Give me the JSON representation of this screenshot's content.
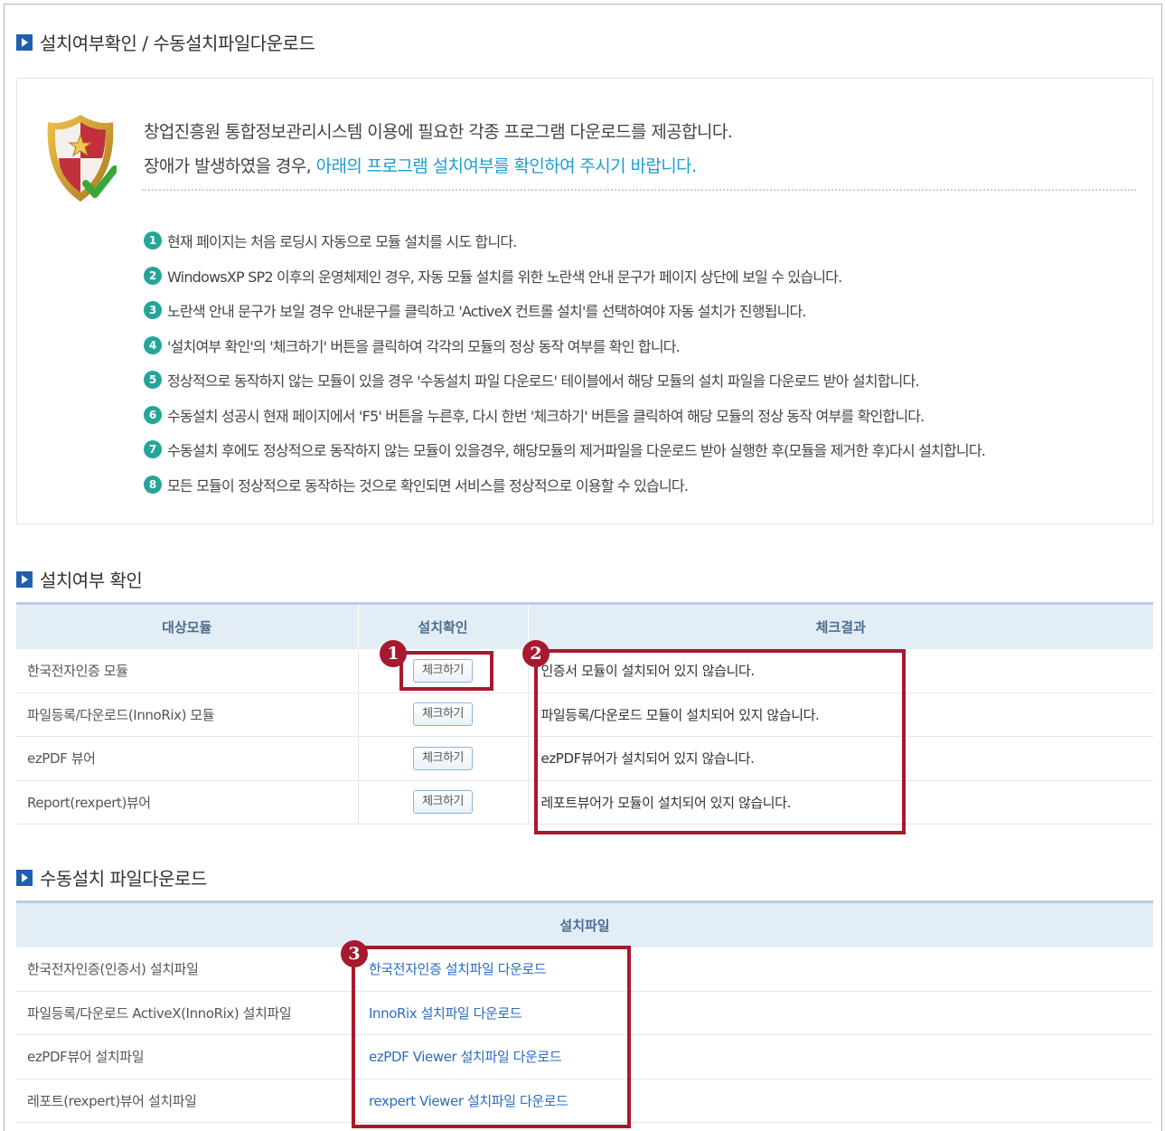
{
  "sections": {
    "main_title": "설치여부확인 / 수동설치파일다운로드",
    "check_title": "설치여부 확인",
    "download_title": "수동설치 파일다운로드"
  },
  "intro": {
    "line1": "창업진흥원 통합정보관리시스템 이용에 필요한 각종 프로그램 다운로드를 제공합니다.",
    "line2_plain": "장애가 발생하였을 경우, ",
    "line2_highlight": "아래의 프로그램 설치여부를 확인하여 주시기 바랍니다."
  },
  "steps": [
    {
      "num": "1",
      "text": "현재 페이지는 처음 로딩시 자동으로 모듈 설치를 시도 합니다."
    },
    {
      "num": "2",
      "text": "WindowsXP SP2 이후의 운영체제인 경우, 자동 모듈 설치를 위한 노란색 안내 문구가 페이지 상단에 보일 수 있습니다."
    },
    {
      "num": "3",
      "text": "노란색 안내 문구가 보일 경우 안내문구를 클릭하고 'ActiveX 컨트롤 설치'를 선택하여야 자동 설치가 진행됩니다."
    },
    {
      "num": "4",
      "text": "'설치여부 확인'의 '체크하기' 버튼을 클릭하여 각각의 모듈의 정상 동작 여부를 확인 합니다."
    },
    {
      "num": "5",
      "text": "정상적으로 동작하지 않는 모듈이 있을 경우 '수동설치 파일 다운로드' 테이블에서 해당 모듈의 설치 파일을 다운로드 받아 설치합니다."
    },
    {
      "num": "6",
      "text": "수동설치 성공시 현재 페이지에서 'F5' 버튼을 누른후, 다시 한번 '체크하기' 버튼을 클릭하여 해당 모듈의 정상 동작 여부를 확인합니다."
    },
    {
      "num": "7",
      "text": "수동설치 후에도 정상적으로 동작하지 않는 모듈이 있을경우, 해당모듈의 제거파일을 다운로드 받아 실행한 후(모듈을 제거한 후)다시 설치합니다."
    },
    {
      "num": "8",
      "text": "모든 모듈이 정상적으로 동작하는 것으로 확인되면 서비스를 정상적으로 이용할 수 있습니다."
    }
  ],
  "check_table": {
    "headers": [
      "대상모듈",
      "설치확인",
      "체크결과"
    ],
    "button_label": "체크하기",
    "rows": [
      {
        "module": "한국전자인증 모듈",
        "result": "인증서 모듈이 설치되어 있지 않습니다."
      },
      {
        "module": "파일등록/다운로드(InnoRix) 모듈",
        "result": "파일등록/다운로드 모듈이 설치되어 있지 않습니다."
      },
      {
        "module": "ezPDF 뷰어",
        "result": "ezPDF뷰어가 설치되어 있지 않습니다."
      },
      {
        "module": "Report(rexpert)뷰어",
        "result": "레포트뷰어가 모듈이 설치되어 있지 않습니다."
      }
    ]
  },
  "download_table": {
    "header": "설치파일",
    "rows": [
      {
        "name": "한국전자인증(인증서) 설치파일",
        "link": "한국전자인증 설치파일 다운로드"
      },
      {
        "name": "파일등록/다운로드 ActiveX(InnoRix) 설치파일",
        "link": "InnoRix 설치파일 다운로드"
      },
      {
        "name": "ezPDF뷰어 설치파일",
        "link": "ezPDF Viewer 설치파일 다운로드"
      },
      {
        "name": "레포트(rexpert)뷰어 설치파일",
        "link": "rexpert Viewer 설치파일 다운로드"
      }
    ]
  },
  "annotations": {
    "badge1": "1",
    "badge2": "2",
    "badge3": "3"
  },
  "colors": {
    "accent_blue": "#1f5fae",
    "highlight_text": "#1a9fd0",
    "step_number": "#25a59a",
    "annotation_red": "#a7192f",
    "table_header_bg": "#e3edf6",
    "link": "#2d6bbf"
  },
  "icons": {
    "shield": "shield-check-icon",
    "section_marker": "section-arrow-icon"
  }
}
